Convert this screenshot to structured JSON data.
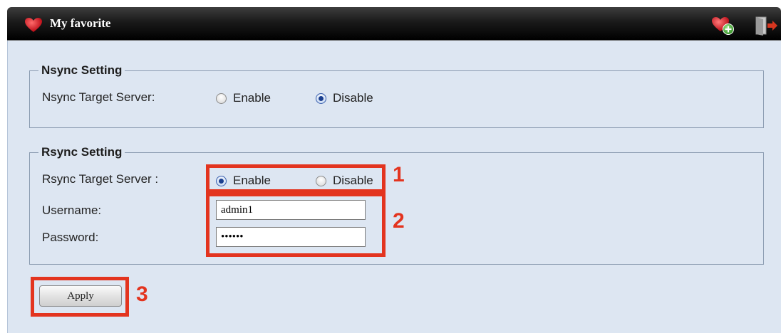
{
  "header": {
    "title": "My favorite",
    "icons": [
      "heart-icon",
      "add-favorite-icon",
      "logout-icon"
    ]
  },
  "nsync": {
    "legend": "Nsync Setting",
    "label": "Nsync Target Server:",
    "options": [
      {
        "label": "Enable",
        "checked": false
      },
      {
        "label": "Disable",
        "checked": true
      }
    ]
  },
  "rsync": {
    "legend": "Rsync Setting",
    "label": "Rsync Target Server :",
    "options": [
      {
        "label": "Enable",
        "checked": true
      },
      {
        "label": "Disable",
        "checked": false
      }
    ],
    "username_label": "Username:",
    "username_value": "admin1",
    "password_label": "Password:",
    "password_value": "••••••"
  },
  "apply_label": "Apply",
  "annotations": {
    "color": "#e3341f",
    "labels": [
      "1",
      "2",
      "3"
    ]
  }
}
